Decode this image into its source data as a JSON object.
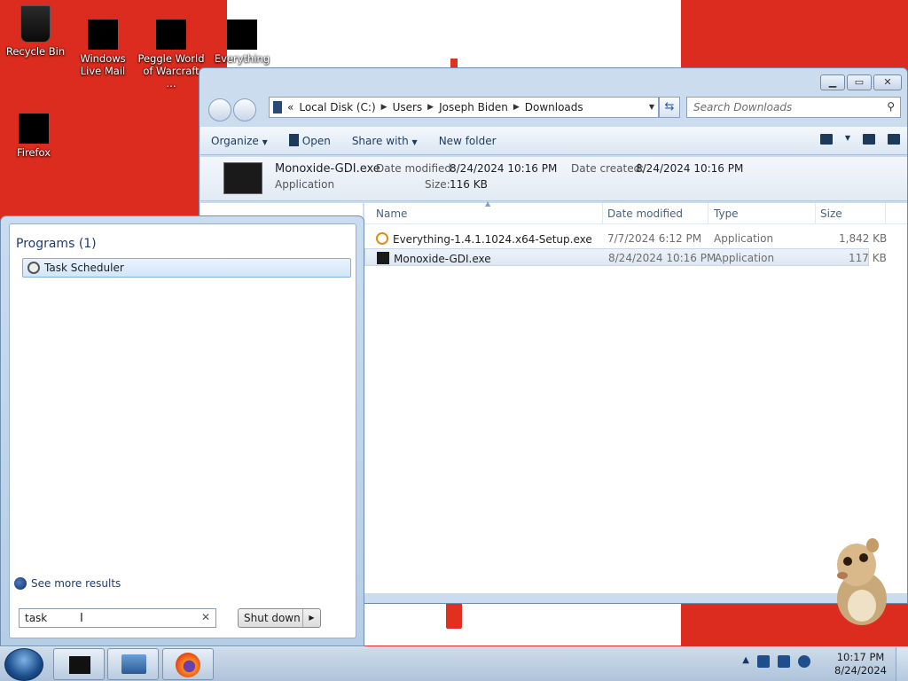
{
  "desktop": {
    "icons": [
      {
        "label": "Recycle Bin"
      },
      {
        "label": "Windows Live Mail"
      },
      {
        "label": "Peggle World of Warcraft ..."
      },
      {
        "label": "Everything"
      },
      {
        "label": "Firefox"
      }
    ]
  },
  "explorer": {
    "address": {
      "prefix": "«",
      "segments": [
        "Local Disk (C:)",
        "Users",
        "Joseph Biden",
        "Downloads"
      ]
    },
    "search_placeholder": "Search Downloads",
    "toolbar": {
      "organize": "Organize",
      "open": "Open",
      "share_with": "Share with",
      "new_folder": "New folder"
    },
    "details": {
      "file_name": "Monoxide-GDI.exe",
      "date_modified_label": "Date modified:",
      "date_modified": "8/24/2024 10:16 PM",
      "date_created_label": "Date created:",
      "date_created": "8/24/2024 10:16 PM",
      "type": "Application",
      "size_label": "Size:",
      "size": "116 KB"
    },
    "columns": {
      "name": "Name",
      "date_modified": "Date modified",
      "type": "Type",
      "size": "Size"
    },
    "files": [
      {
        "name": "Everything-1.4.1.1024.x64-Setup.exe",
        "date": "7/7/2024 6:12 PM",
        "type": "Application",
        "size": "1,842 KB"
      },
      {
        "name": "Monoxide-GDI.exe",
        "date": "8/24/2024 10:16 PM",
        "type": "Application",
        "size": "117 KB"
      }
    ]
  },
  "start_menu": {
    "programs_header": "Programs (1)",
    "result": "Task Scheduler",
    "see_more": "See more results",
    "search_value": "task",
    "shutdown": "Shut down"
  },
  "taskbar": {
    "time": "10:17 PM",
    "date": "8/24/2024"
  }
}
